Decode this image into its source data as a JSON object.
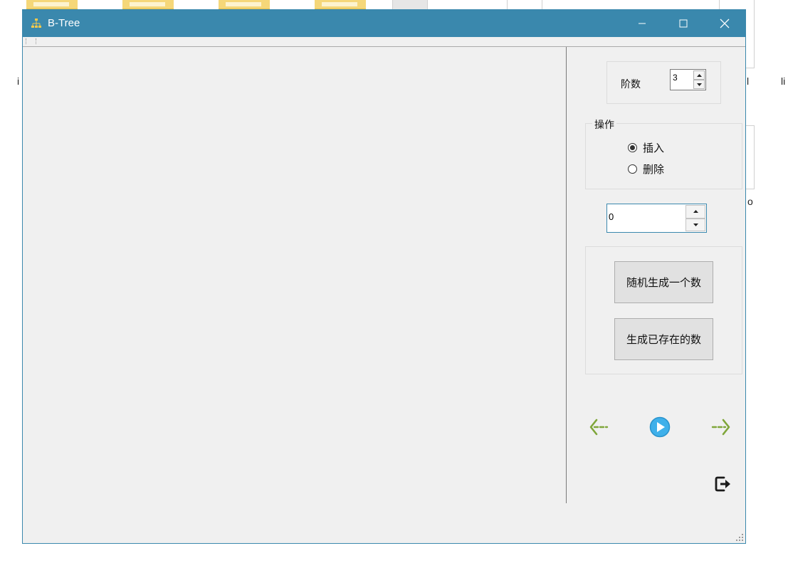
{
  "desktop": {
    "labels": [
      "i",
      "l",
      "li",
      "o"
    ]
  },
  "window": {
    "title": "B-Tree",
    "icon": "tree-structure-icon",
    "controls": {
      "minimize_icon": "minimize-icon",
      "maximize_icon": "maximize-icon",
      "close_icon": "close-icon"
    },
    "accent_color": "#3a88ad"
  },
  "panel": {
    "order": {
      "label": "阶数",
      "value": "3"
    },
    "operation": {
      "legend": "操作",
      "options": [
        {
          "label": "插入",
          "selected": true
        },
        {
          "label": "删除",
          "selected": false
        }
      ]
    },
    "number_input": {
      "value": "0"
    },
    "buttons": {
      "random_label": "随机生成一个数",
      "existing_label": "生成已存在的数"
    },
    "playback": {
      "prev_icon": "arrow-left-icon",
      "play_icon": "play-icon",
      "next_icon": "arrow-right-icon"
    },
    "exit_icon": "exit-icon"
  }
}
